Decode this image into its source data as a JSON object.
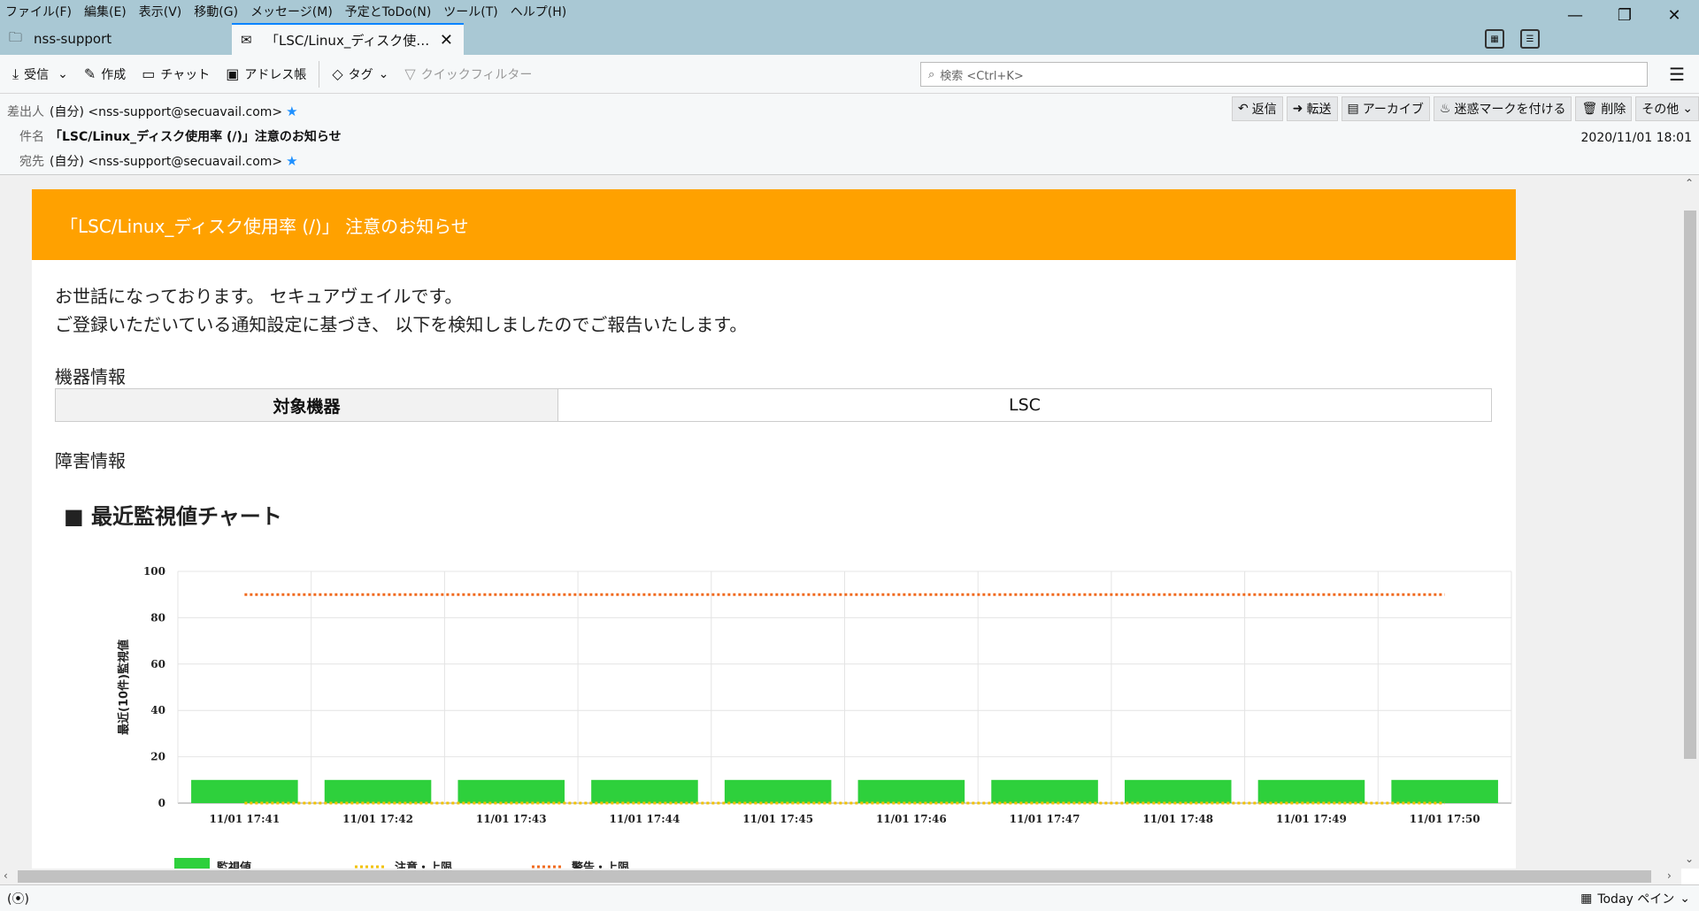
{
  "menu": [
    "ファイル(F)",
    "編集(E)",
    "表示(V)",
    "移動(G)",
    "メッセージ(M)",
    "予定とToDo(N)",
    "ツール(T)",
    "ヘルプ(H)"
  ],
  "window_controls": {
    "minimize": "—",
    "restore": "❐",
    "close": "✕"
  },
  "tabs": [
    {
      "label": "nss-support",
      "icon": "folder-icon"
    },
    {
      "label": "「LSC/Linux_ディスク使用率 (/)」注意のお知らせ",
      "icon": "mail-icon"
    }
  ],
  "toolbar": {
    "get": "受信",
    "write": "作成",
    "chat": "チャット",
    "address_book": "アドレス帳",
    "tag": "タグ",
    "quick_filter": "クイックフィルター",
    "search_placeholder": "検索 <Ctrl+K>"
  },
  "header": {
    "from_label": "差出人",
    "from_value": "(自分) <nss-support@secuavail.com>",
    "subject_label": "件名",
    "subject_value": "「LSC/Linux_ディスク使用率 (/)」注意のお知らせ",
    "to_label": "宛先",
    "to_value": "(自分) <nss-support@secuavail.com>",
    "date": "2020/11/01 18:01",
    "actions": {
      "reply": "返信",
      "forward": "転送",
      "archive": "アーカイブ",
      "junk": "迷惑マークを付ける",
      "delete": "削除",
      "more": "その他"
    }
  },
  "message": {
    "banner": "「LSC/Linux_ディスク使用率 (/)」 注意のお知らせ",
    "greeting1": "お世話になっております。 セキュアヴェイルです。",
    "greeting2": "ご登録いただいている通知設定に基づき、 以下を検知しましたのでご報告いたします。",
    "device_section": "機器情報",
    "device_th": "対象機器",
    "device_td": "LSC",
    "fault_section": "障害情報",
    "chart_heading": "■ 最近監視値チャート"
  },
  "chart_data": {
    "type": "bar",
    "categories": [
      "11/01 17:41",
      "11/01 17:42",
      "11/01 17:43",
      "11/01 17:44",
      "11/01 17:45",
      "11/01 17:46",
      "11/01 17:47",
      "11/01 17:48",
      "11/01 17:49",
      "11/01 17:50"
    ],
    "series": [
      {
        "name": "監視値",
        "type": "bar",
        "color": "#2ed03c",
        "values": [
          10,
          10,
          10,
          10,
          10,
          10,
          10,
          10,
          10,
          10
        ]
      },
      {
        "name": "注意・上限",
        "type": "line",
        "color": "#f2c200",
        "values": [
          0,
          0,
          0,
          0,
          0,
          0,
          0,
          0,
          0,
          0
        ]
      },
      {
        "name": "警告・上限",
        "type": "line",
        "color": "#f06a1e",
        "values": [
          90,
          90,
          90,
          90,
          90,
          90,
          90,
          90,
          90,
          90
        ]
      }
    ],
    "ylabel": "最近(10件)監視値",
    "ylim": [
      0,
      100
    ],
    "yticks": [
      0,
      20,
      40,
      60,
      80,
      100
    ],
    "grid": true,
    "legend": "bottom-left"
  },
  "status": {
    "left_icon": "(⦿)",
    "today_pane": "Today ペイン"
  }
}
